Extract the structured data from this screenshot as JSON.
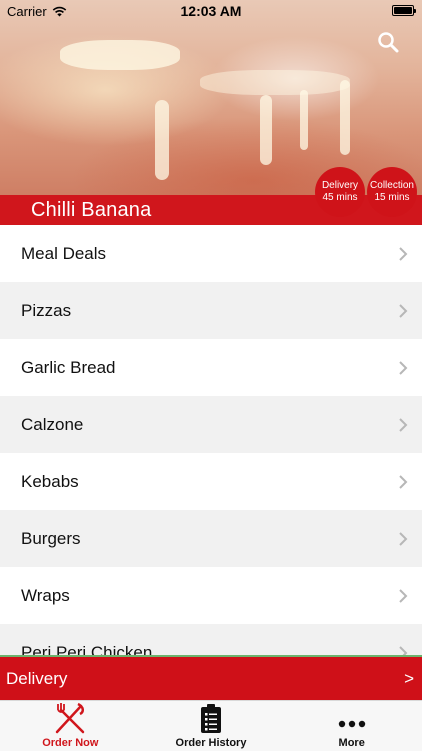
{
  "status_bar": {
    "carrier": "Carrier",
    "time": "12:03 AM"
  },
  "header": {
    "restaurant_name": "Chilli Banana",
    "delivery_badge": {
      "label": "Delivery",
      "time": "45 mins"
    },
    "collection_badge": {
      "label": "Collection",
      "time": "15 mins"
    }
  },
  "menu": {
    "categories": [
      "Meal Deals",
      "Pizzas",
      "Garlic Bread",
      "Calzone",
      "Kebabs",
      "Burgers",
      "Wraps",
      "Peri Peri Chicken"
    ]
  },
  "order_bar": {
    "mode": "Delivery",
    "arrow": ">"
  },
  "tabs": [
    {
      "label": "Order Now",
      "icon": "fork-knife-icon",
      "active": true
    },
    {
      "label": "Order History",
      "icon": "clipboard-icon",
      "active": false
    },
    {
      "label": "More",
      "icon": "more-dots-icon",
      "active": false
    }
  ],
  "colors": {
    "brand_red": "#d0161c",
    "accent_green": "#6db36d"
  }
}
